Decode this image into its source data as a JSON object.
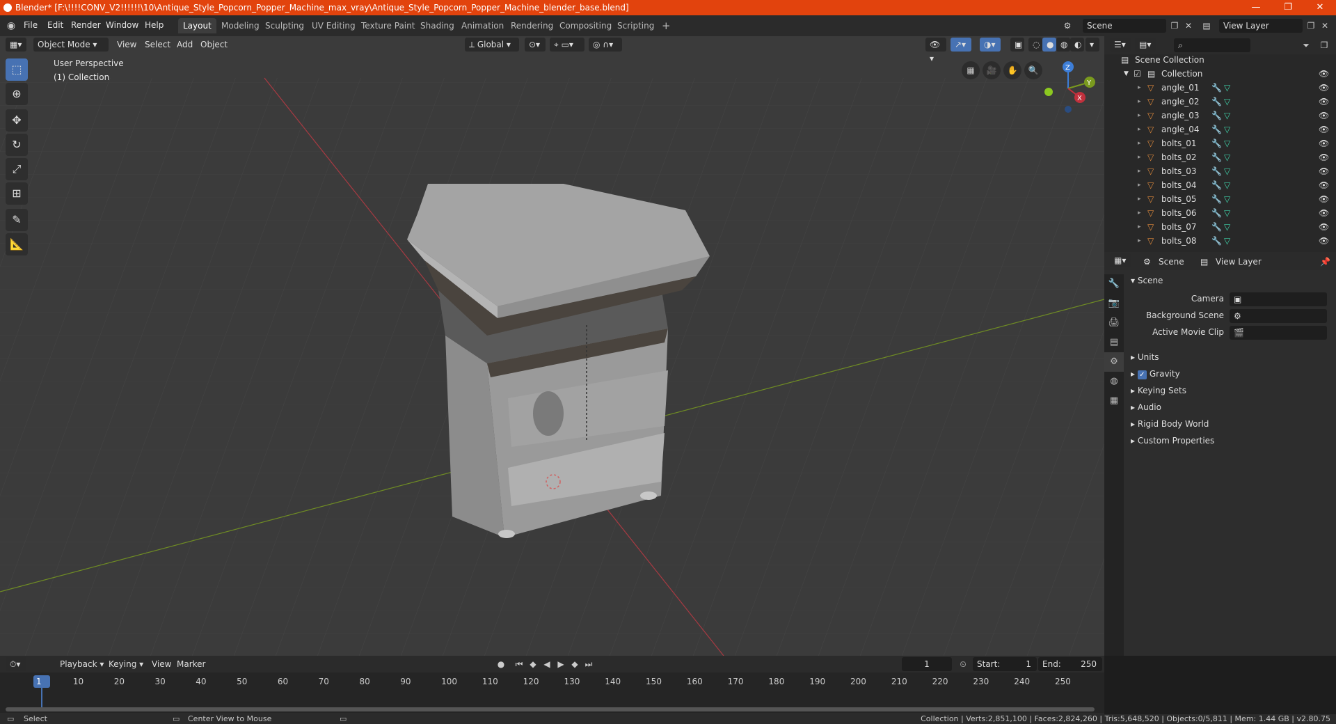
{
  "title_bar": {
    "title": "Blender* [F:\\!!!!CONV_V2!!!!!!\\10\\Antique_Style_Popcorn_Popper_Machine_max_vray\\Antique_Style_Popcorn_Popper_Machine_blender_base.blend]",
    "minimize": "—",
    "maximize": "❐",
    "close": "✕"
  },
  "menus": [
    "File",
    "Edit",
    "Render",
    "Window",
    "Help"
  ],
  "workspaces": [
    "Layout",
    "Modeling",
    "Sculpting",
    "UV Editing",
    "Texture Paint",
    "Shading",
    "Animation",
    "Rendering",
    "Compositing",
    "Scripting"
  ],
  "active_workspace": "Layout",
  "add_workspace": "+",
  "scene_field": "Scene",
  "view_layer_field": "View Layer",
  "viewport_header": {
    "mode": "Object Mode",
    "menus": [
      "View",
      "Select",
      "Add",
      "Object"
    ],
    "orientation": "Global"
  },
  "viewport_overlay": {
    "perspective": "User Perspective",
    "collection": "(1) Collection"
  },
  "gizmo": {
    "x": "X",
    "y": "Y",
    "z": "Z"
  },
  "outliner": {
    "scene_collection": "Scene Collection",
    "collection": "Collection",
    "items": [
      "angle_01",
      "angle_02",
      "angle_03",
      "angle_04",
      "bolts_01",
      "bolts_02",
      "bolts_03",
      "bolts_04",
      "bolts_05",
      "bolts_06",
      "bolts_07",
      "bolts_08"
    ]
  },
  "properties": {
    "tab_scene": "Scene",
    "tab_view_layer": "View Layer",
    "panel_title": "Scene",
    "camera_label": "Camera",
    "background_scene_label": "Background Scene",
    "active_movie_clip_label": "Active Movie Clip",
    "sections": [
      "Units",
      "Gravity",
      "Keying Sets",
      "Audio",
      "Rigid Body World",
      "Custom Properties"
    ],
    "gravity_checked": true
  },
  "timeline": {
    "menus": [
      "Playback",
      "Keying",
      "View",
      "Marker"
    ],
    "current_frame": "1",
    "start_label": "Start:",
    "start": "1",
    "end_label": "End:",
    "end": "250",
    "ruler": [
      "1",
      "10",
      "20",
      "30",
      "40",
      "50",
      "60",
      "70",
      "80",
      "90",
      "100",
      "110",
      "120",
      "130",
      "140",
      "150",
      "160",
      "170",
      "180",
      "190",
      "200",
      "210",
      "220",
      "230",
      "240",
      "250"
    ]
  },
  "statusbar": {
    "select": "Select",
    "center_view": "Center View to Mouse",
    "stats": "Collection | Verts:2,851,100 | Faces:2,824,260 | Tris:5,648,520 | Objects:0/5,811 | Mem: 1.44 GB | v2.80.75"
  },
  "colors": {
    "title_bar": "#e2430d",
    "accent": "#4772b3",
    "x_axis": "#c0303c",
    "y_axis": "#7a9a1e",
    "object_icon": "#e08a3c",
    "modifier_icon": "#5aa6e8",
    "mesh_icon": "#3fd1a8"
  }
}
